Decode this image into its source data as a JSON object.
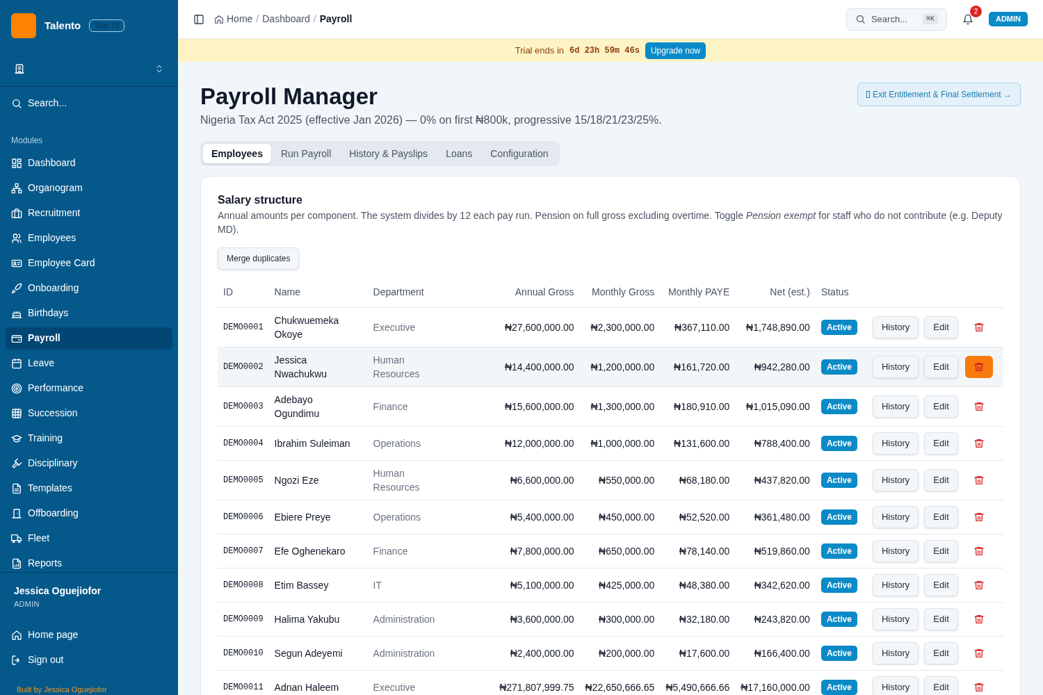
{
  "app": {
    "name": "Talento",
    "trial_badge": "Trial 7d"
  },
  "sidebar": {
    "search": "Search...",
    "section": "Modules",
    "items": [
      {
        "label": "Dashboard",
        "selected": false
      },
      {
        "label": "Organogram",
        "selected": false
      },
      {
        "label": "Recruitment",
        "selected": false
      },
      {
        "label": "Employees",
        "selected": false
      },
      {
        "label": "Employee Card",
        "selected": false
      },
      {
        "label": "Onboarding",
        "selected": false
      },
      {
        "label": "Birthdays",
        "selected": false
      },
      {
        "label": "Payroll",
        "selected": true
      },
      {
        "label": "Leave",
        "selected": false
      },
      {
        "label": "Performance",
        "selected": false
      },
      {
        "label": "Succession",
        "selected": false
      },
      {
        "label": "Training",
        "selected": false
      },
      {
        "label": "Disciplinary",
        "selected": false
      },
      {
        "label": "Templates",
        "selected": false
      },
      {
        "label": "Offboarding",
        "selected": false
      },
      {
        "label": "Fleet",
        "selected": false
      },
      {
        "label": "Reports",
        "selected": false
      }
    ],
    "user": {
      "name": "Jessica Oguejiofor",
      "role": "ADMIN"
    },
    "links": [
      "Home page",
      "Sign out"
    ],
    "footer": "Built by Jessica Oguejiofor"
  },
  "header": {
    "breadcrumb": [
      "Home",
      "Dashboard",
      "Payroll"
    ],
    "separator": "/",
    "search": "Search...",
    "shortcut": "⌘K",
    "notifications": "2",
    "role_badge": "ADMIN"
  },
  "trial_banner": {
    "text": "Trial ends in",
    "countdown": "6d 23h 59m 46s",
    "button": "Upgrade now"
  },
  "page": {
    "title": "Payroll Manager",
    "subtitle": "Nigeria Tax Act 2025 (effective Jan 2026) — 0% on first ₦800k, progressive 15/18/21/23/25%.",
    "action": "Exit Entitlement & Final Settlement →"
  },
  "tabs": [
    {
      "label": "Employees",
      "selected": true
    },
    {
      "label": "Run Payroll",
      "selected": false
    },
    {
      "label": "History & Payslips",
      "selected": false
    },
    {
      "label": "Loans",
      "selected": false
    },
    {
      "label": "Configuration",
      "selected": false
    }
  ],
  "card": {
    "title": "Salary structure",
    "description": "Annual amounts per component. The system divides by 12 each pay run. Pension on full gross excluding overtime. Toggle *Pension exempt* for staff who do not contribute (e.g. Deputy MD).",
    "button": "Merge duplicates"
  },
  "table": {
    "columns": [
      "ID",
      "Name",
      "Department",
      "Annual Gross",
      "Monthly Gross",
      "Monthly PAYE",
      "Net (est.)",
      "Status"
    ],
    "rows": [
      {
        "cells": [
          "DEMO0001",
          "Chukwuemeka Okoye",
          "Executive",
          "₦27,600,000.00",
          "₦2,300,000.00",
          "₦367,110.00",
          "₦1,748,890.00"
        ],
        "status": "Active",
        "hovered": false,
        "actions": [
          "History",
          "Edit"
        ]
      },
      {
        "cells": [
          "DEMO0002",
          "Jessica Nwachukwu",
          "Human Resources",
          "₦14,400,000.00",
          "₦1,200,000.00",
          "₦161,720.00",
          "₦942,280.00"
        ],
        "status": "Active",
        "hovered": true,
        "actions": [
          "History",
          "Edit"
        ]
      },
      {
        "cells": [
          "DEMO0003",
          "Adebayo Ogundimu",
          "Finance",
          "₦15,600,000.00",
          "₦1,300,000.00",
          "₦180,910.00",
          "₦1,015,090.00"
        ],
        "status": "Active",
        "hovered": false,
        "actions": [
          "History",
          "Edit"
        ]
      },
      {
        "cells": [
          "DEMO0004",
          "Ibrahim Suleiman",
          "Operations",
          "₦12,000,000.00",
          "₦1,000,000.00",
          "₦131,600.00",
          "₦788,400.00"
        ],
        "status": "Active",
        "hovered": false,
        "actions": [
          "History",
          "Edit"
        ]
      },
      {
        "cells": [
          "DEMO0005",
          "Ngozi Eze",
          "Human Resources",
          "₦6,600,000.00",
          "₦550,000.00",
          "₦68,180.00",
          "₦437,820.00"
        ],
        "status": "Active",
        "hovered": false,
        "actions": [
          "History",
          "Edit"
        ]
      },
      {
        "cells": [
          "DEMO0006",
          "Ebiere Preye",
          "Operations",
          "₦5,400,000.00",
          "₦450,000.00",
          "₦52,520.00",
          "₦361,480.00"
        ],
        "status": "Active",
        "hovered": false,
        "actions": [
          "History",
          "Edit"
        ]
      },
      {
        "cells": [
          "DEMO0007",
          "Efe Oghenekaro",
          "Finance",
          "₦7,800,000.00",
          "₦650,000.00",
          "₦78,140.00",
          "₦519,860.00"
        ],
        "status": "Active",
        "hovered": false,
        "actions": [
          "History",
          "Edit"
        ]
      },
      {
        "cells": [
          "DEMO0008",
          "Etim Bassey",
          "IT",
          "₦5,100,000.00",
          "₦425,000.00",
          "₦48,380.00",
          "₦342,620.00"
        ],
        "status": "Active",
        "hovered": false,
        "actions": [
          "History",
          "Edit"
        ]
      },
      {
        "cells": [
          "DEMO0009",
          "Halima Yakubu",
          "Administration",
          "₦3,600,000.00",
          "₦300,000.00",
          "₦32,180.00",
          "₦243,820.00"
        ],
        "status": "Active",
        "hovered": false,
        "actions": [
          "History",
          "Edit"
        ]
      },
      {
        "cells": [
          "DEMO0010",
          "Segun Adeyemi",
          "Administration",
          "₦2,400,000.00",
          "₦200,000.00",
          "₦17,600.00",
          "₦166,400.00"
        ],
        "status": "Active",
        "hovered": false,
        "actions": [
          "History",
          "Edit"
        ]
      },
      {
        "cells": [
          "DEMO0011",
          "Adnan Haleem",
          "Executive",
          "₦271,807,999.75",
          "₦22,650,666.65",
          "₦5,490,666.66",
          "₦17,160,000.00"
        ],
        "status": "Active",
        "hovered": false,
        "actions": [
          "History",
          "Edit"
        ]
      }
    ]
  }
}
